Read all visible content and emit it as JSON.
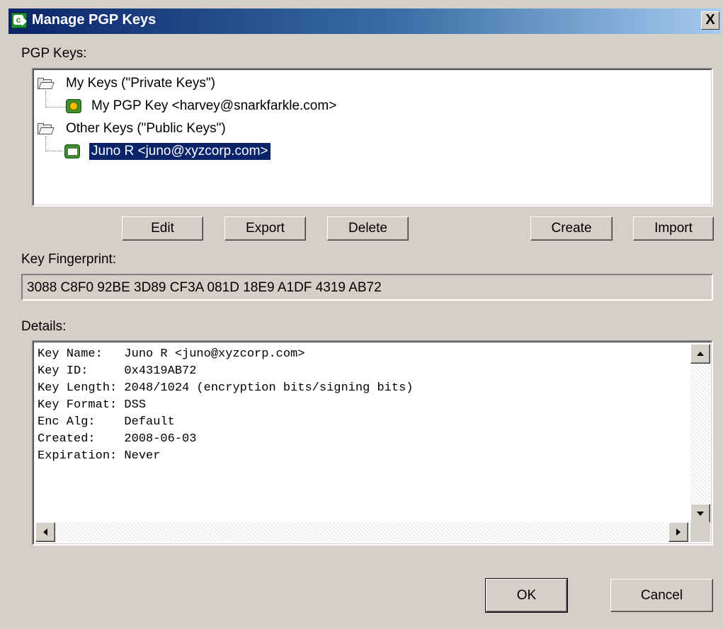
{
  "window": {
    "title": "Manage PGP Keys",
    "close_label": "X"
  },
  "pgp_keys": {
    "label": "PGP Keys:",
    "tree": {
      "private_folder": "My Keys (\"Private Keys\")",
      "private_key": "My PGP Key <harvey@snarkfarkle.com>",
      "public_folder": "Other Keys (\"Public Keys\")",
      "public_key": "Juno R <juno@xyzcorp.com>"
    },
    "selected_item": "Juno R <juno@xyzcorp.com>"
  },
  "actions": {
    "edit": "Edit",
    "export": "Export",
    "delete": "Delete",
    "create": "Create",
    "import": "Import"
  },
  "fingerprint": {
    "label": "Key Fingerprint:",
    "value": "3088 C8F0 92BE 3D89 CF3A 081D 18E9 A1DF 4319 AB72"
  },
  "details": {
    "label": "Details:",
    "lines": [
      "Key Name:   Juno R <juno@xyzcorp.com>",
      "Key ID:     0x4319AB72",
      "Key Length: 2048/1024 (encryption bits/signing bits)",
      "Key Format: DSS",
      "Enc Alg:    Default",
      "Created:    2008-06-03",
      "Expiration: Never"
    ]
  },
  "footer": {
    "ok": "OK",
    "cancel": "Cancel"
  },
  "colors": {
    "title_start": "#0a246a",
    "title_end": "#a6caf0",
    "selection": "#0a246a",
    "face": "#d4d0c8"
  }
}
